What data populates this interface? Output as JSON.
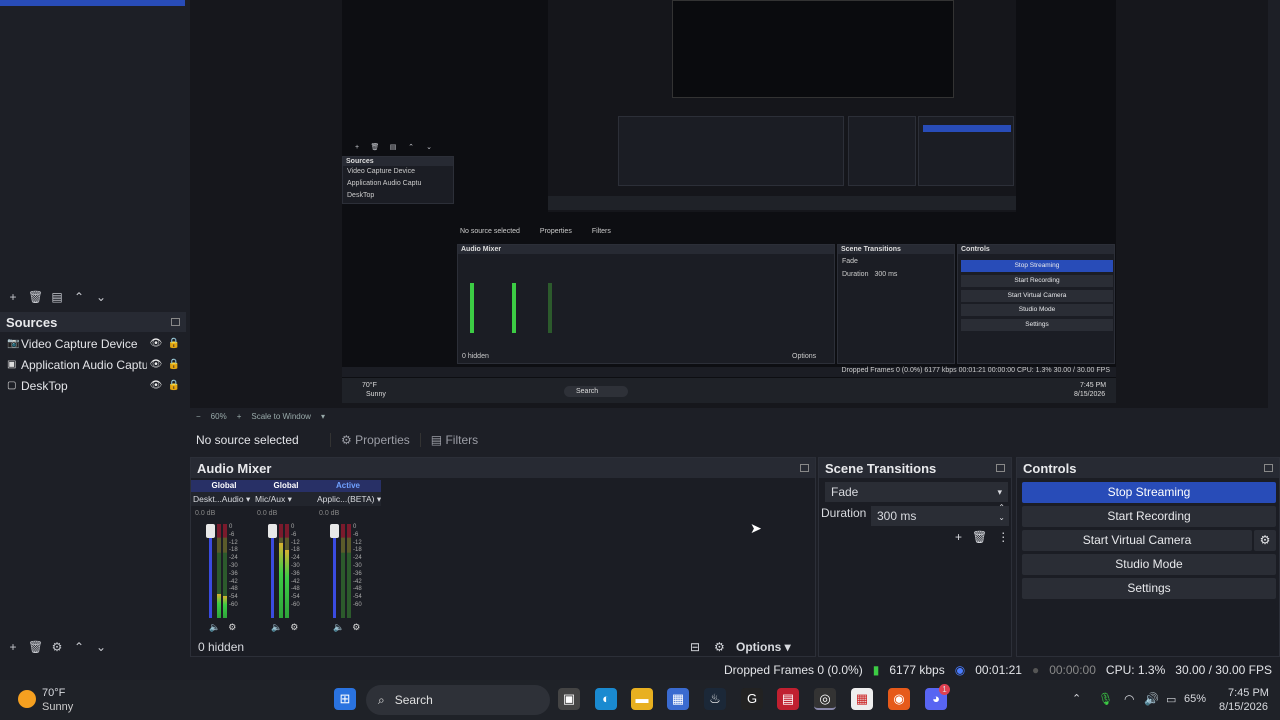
{
  "sources": {
    "title": "Sources",
    "items": [
      {
        "label": "Video Capture Device",
        "icon": "camera-icon"
      },
      {
        "label": "Application Audio Captu",
        "icon": "app-audio-icon"
      },
      {
        "label": "DeskTop",
        "icon": "monitor-icon"
      }
    ]
  },
  "preview": {
    "zoom": "60%",
    "scale_mode": "Scale to Window",
    "mini": {
      "sources_title": "Sources",
      "sources": [
        "Video Capture Device",
        "Application Audio Captu",
        "DeskTop"
      ],
      "no_source": "No source selected",
      "properties": "Properties",
      "filters": "Filters",
      "audio_mixer": "Audio Mixer",
      "scene_transitions": "Scene Transitions",
      "controls": "Controls",
      "fade": "Fade",
      "duration_label": "Duration",
      "duration_value": "300 ms",
      "buttons": [
        "Stop Streaming",
        "Start Recording",
        "Start Virtual Camera",
        "Studio Mode",
        "Settings"
      ],
      "hidden": "0 hidden",
      "options": "Options",
      "status": "Dropped Frames 0 (0.0%)  6177 kbps  00:01:21  00:00:00  CPU: 1.3%  30.00 / 30.00 FPS",
      "weather_temp": "70°F",
      "weather_desc": "Sunny",
      "search": "Search",
      "time": "7:45 PM",
      "date": "8/15/2026"
    }
  },
  "context": {
    "no_source": "No source selected",
    "properties": "Properties",
    "filters": "Filters"
  },
  "mixer": {
    "title": "Audio Mixer",
    "channels": [
      {
        "type": "Global",
        "name": "Deskt...Audio",
        "db": "0.0 dB",
        "level": 0.25
      },
      {
        "type": "Global",
        "name": "Mic/Aux",
        "db": "0.0 dB",
        "level": 0.8
      },
      {
        "type": "Active",
        "name": "Applic...(BETA)",
        "db": "0.0 dB",
        "level": 0.0
      }
    ],
    "scale": [
      "0",
      "-6",
      "-12",
      "-18",
      "-24",
      "-30",
      "-36",
      "-42",
      "-48",
      "-54",
      "-60"
    ],
    "hidden": "0 hidden",
    "options": "Options"
  },
  "transitions": {
    "title": "Scene Transitions",
    "selected": "Fade",
    "duration_label": "Duration",
    "duration_value": "300 ms"
  },
  "controls": {
    "title": "Controls",
    "stop_streaming": "Stop Streaming",
    "start_recording": "Start Recording",
    "start_virtual_camera": "Start Virtual Camera",
    "studio_mode": "Studio Mode",
    "settings": "Settings"
  },
  "status": {
    "dropped": "Dropped Frames 0 (0.0%)",
    "kbps": "6177 kbps",
    "stream_time": "00:01:21",
    "rec_time": "00:00:00",
    "cpu": "CPU: 1.3%",
    "fps": "30.00 / 30.00 FPS"
  },
  "taskbar": {
    "weather_temp": "70°F",
    "weather_desc": "Sunny",
    "search": "Search",
    "battery": "65%",
    "time": "7:45 PM",
    "date": "8/15/2026",
    "badge": "1"
  },
  "colors": {
    "accent": "#284cb8",
    "background": "#1d1f26",
    "meter_green": "#3ccc44"
  }
}
